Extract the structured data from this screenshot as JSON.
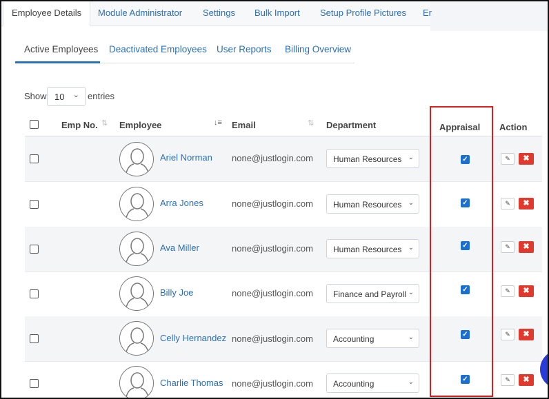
{
  "top_tabs": [
    "Employee Details",
    "Module Administrator",
    "Settings",
    "Bulk Import",
    "Setup Profile Pictures",
    "Er"
  ],
  "sub_tabs": [
    "Active Employees",
    "Deactivated Employees",
    "User Reports",
    "Billing Overview"
  ],
  "show_entries": {
    "show_label": "Show",
    "value": "10",
    "entries_label": "entries"
  },
  "table": {
    "headers": {
      "emp_no": "Emp No.",
      "employee": "Employee",
      "email": "Email",
      "department": "Department",
      "appraisal": "Appraisal",
      "action": "Action"
    },
    "rows": [
      {
        "name": "Ariel Norman",
        "email": "none@justlogin.com",
        "department": "Human Resources",
        "appraisal": true
      },
      {
        "name": "Arra Jones",
        "email": "none@justlogin.com",
        "department": "Human Resources",
        "appraisal": true
      },
      {
        "name": "Ava Miller",
        "email": "none@justlogin.com",
        "department": "Human Resources",
        "appraisal": true
      },
      {
        "name": "Billy Joe",
        "email": "none@justlogin.com",
        "department": "Finance and Payroll",
        "appraisal": true
      },
      {
        "name": "Celly Hernandez",
        "email": "none@justlogin.com",
        "department": "Accounting",
        "appraisal": true
      },
      {
        "name": "Charlie Thomas",
        "email": "none@justlogin.com",
        "department": "Accounting",
        "appraisal": true
      }
    ]
  },
  "colors": {
    "accent": "#2a6fb8",
    "checkbox": "#1a6fd1",
    "delete": "#e03a2f",
    "highlight": "#e01b1b"
  },
  "icons": [
    "sort-icon",
    "sort-desc-icon",
    "chevron-down-icon",
    "user-avatar-icon",
    "checkmark-icon",
    "pencil-icon",
    "delete-x-icon"
  ]
}
